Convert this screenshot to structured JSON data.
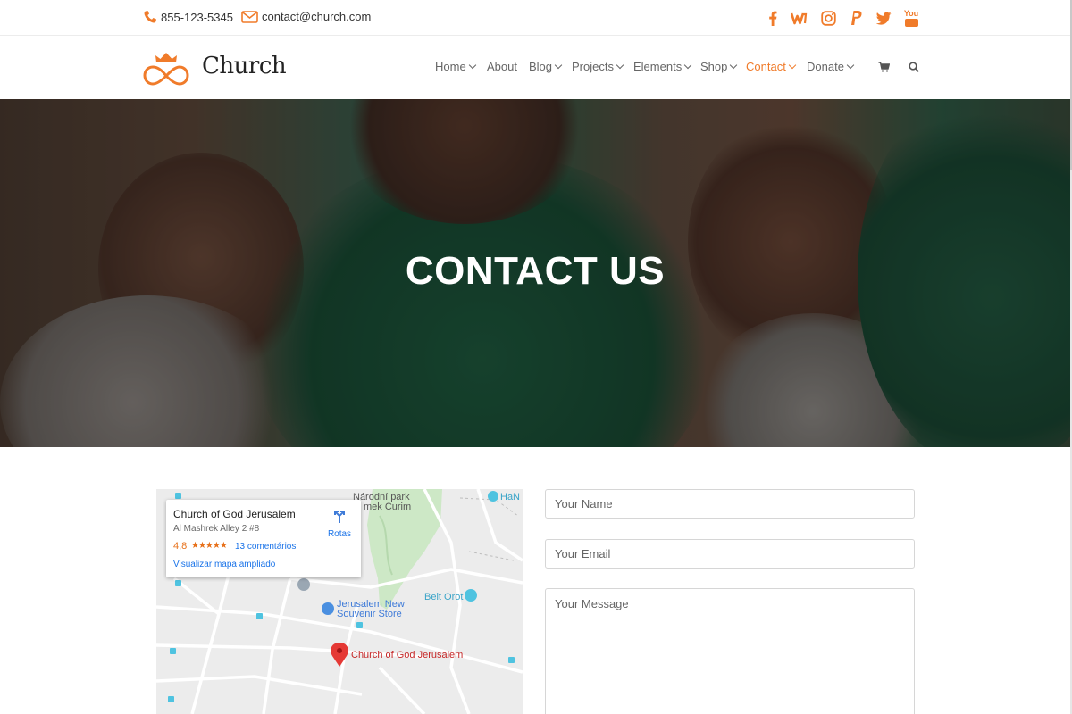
{
  "topbar": {
    "phone": "855-123-5345",
    "email": "contact@church.com",
    "social_icons": [
      "facebook-icon",
      "ebay-icon",
      "instagram-icon",
      "paypal-icon",
      "twitter-icon",
      "youtube-icon"
    ],
    "youtube_label": "You"
  },
  "brand": {
    "name": "Church",
    "accent": "#f07b2a"
  },
  "nav": {
    "items": [
      {
        "label": "Home",
        "dropdown": true
      },
      {
        "label": "About",
        "dropdown": false
      },
      {
        "label": "Blog",
        "dropdown": true
      },
      {
        "label": "Projects",
        "dropdown": true
      },
      {
        "label": "Elements",
        "dropdown": true
      },
      {
        "label": "Shop",
        "dropdown": true
      },
      {
        "label": "Contact",
        "dropdown": true,
        "active": true
      },
      {
        "label": "Donate",
        "dropdown": true
      }
    ],
    "icons": [
      "cart-icon",
      "search-icon"
    ]
  },
  "hero": {
    "title": "CONTACT US"
  },
  "map": {
    "place_name": "Church of God Jerusalem",
    "address": "Al Mashrek Alley 2 #8",
    "rating": "4,8",
    "stars": "★★★★★",
    "reviews": "13 comentários",
    "larger_map": "Visualizar mapa ampliado",
    "directions": "Rotas",
    "labels": {
      "park": "Národní park",
      "park2": "mek Curim",
      "store1": "Jerusalem New",
      "store2": "Souvenir Store",
      "beit_orot": "Beit Orot",
      "pin_label": "Church of God Jerusalem",
      "ha": "HaN"
    }
  },
  "form": {
    "name_placeholder": "Your Name",
    "email_placeholder": "Your Email",
    "message_placeholder": "Your Message"
  }
}
